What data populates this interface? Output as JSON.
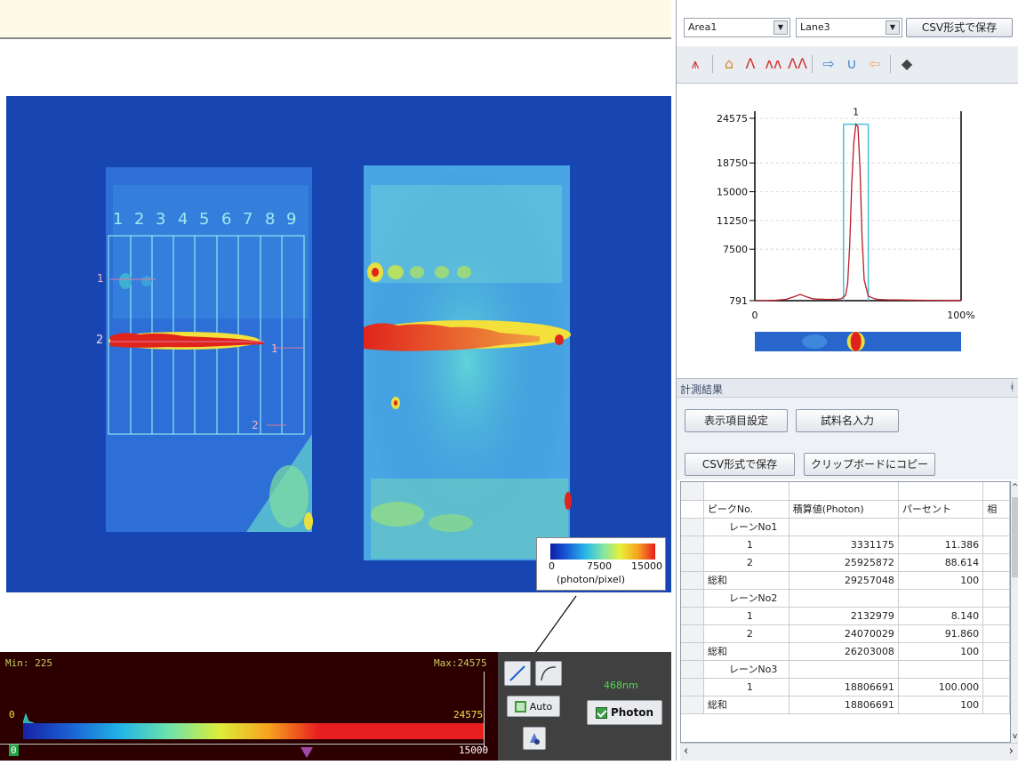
{
  "viewer": {
    "lane_numbers": [
      "1",
      "2",
      "3",
      "4",
      "5",
      "6",
      "7",
      "8",
      "9"
    ],
    "peak_labels": [
      "1",
      "2",
      "1",
      "2"
    ],
    "colorbar": {
      "min": "0",
      "mid": "7500",
      "max": "15000",
      "unit": "(photon/pixel)"
    }
  },
  "histogram": {
    "min_label": "Min: 225",
    "max_label": "Max:24575",
    "zero_left": "0",
    "max_value": "24575",
    "range_low": "0",
    "range_high": "15000"
  },
  "controls": {
    "auto_label": "Auto",
    "wavelength": "468nm",
    "photon_label": "Photon"
  },
  "right_panel": {
    "area_select": "Area1",
    "lane_select": "Lane3",
    "csv_save_top": "CSV形式で保存",
    "results_title": "計測結果",
    "results_pin": "ᚼ",
    "btn_display_settings": "表示項目設定",
    "btn_sample_name": "試料名入力",
    "btn_csv_save": "CSV形式で保存",
    "btn_clipboard": "クリップボードにコピー"
  },
  "chart_data": {
    "type": "line",
    "title": "",
    "xlabel": "",
    "ylabel": "",
    "y_ticks": [
      "24575",
      "18750",
      "15000",
      "11250",
      "7500",
      "791"
    ],
    "x_ticks": [
      "0",
      "100%"
    ],
    "peak_marker": "1",
    "ylim": [
      791,
      24575
    ],
    "xlim": [
      0,
      100
    ],
    "series": [
      {
        "x": [
          0,
          5,
          10,
          15,
          20,
          22,
          25,
          28,
          30,
          35,
          40,
          42,
          44,
          45,
          46,
          47,
          48,
          49,
          50,
          51,
          52,
          53,
          55,
          58,
          60,
          65,
          70,
          75,
          80,
          85,
          90,
          95,
          100
        ],
        "values": [
          791,
          800,
          850,
          950,
          1400,
          1600,
          1300,
          1050,
          1000,
          950,
          980,
          1050,
          1500,
          3000,
          8000,
          16000,
          21500,
          23800,
          23500,
          18000,
          9000,
          3500,
          1400,
          1050,
          950,
          900,
          880,
          860,
          850,
          840,
          830,
          820,
          815
        ]
      }
    ]
  },
  "table": {
    "headers": [
      "ピークNo.",
      "積算値(Photon)",
      "パーセント",
      "相"
    ],
    "rows": [
      {
        "label": "レーンNo1",
        "value": "",
        "pct": "",
        "kind": "lane"
      },
      {
        "label": "1",
        "value": "3331175",
        "pct": "11.386",
        "kind": "peak"
      },
      {
        "label": "2",
        "value": "25925872",
        "pct": "88.614",
        "kind": "peak"
      },
      {
        "label": "総和",
        "value": "29257048",
        "pct": "100",
        "kind": "sum"
      },
      {
        "label": "レーンNo2",
        "value": "",
        "pct": "",
        "kind": "lane"
      },
      {
        "label": "1",
        "value": "2132979",
        "pct": "8.140",
        "kind": "peak"
      },
      {
        "label": "2",
        "value": "24070029",
        "pct": "91.860",
        "kind": "peak"
      },
      {
        "label": "総和",
        "value": "26203008",
        "pct": "100",
        "kind": "sum"
      },
      {
        "label": "レーンNo3",
        "value": "",
        "pct": "",
        "kind": "lane"
      },
      {
        "label": "1",
        "value": "18806691",
        "pct": "100.000",
        "kind": "peak"
      },
      {
        "label": "総和",
        "value": "18806691",
        "pct": "100",
        "kind": "sum"
      }
    ]
  }
}
